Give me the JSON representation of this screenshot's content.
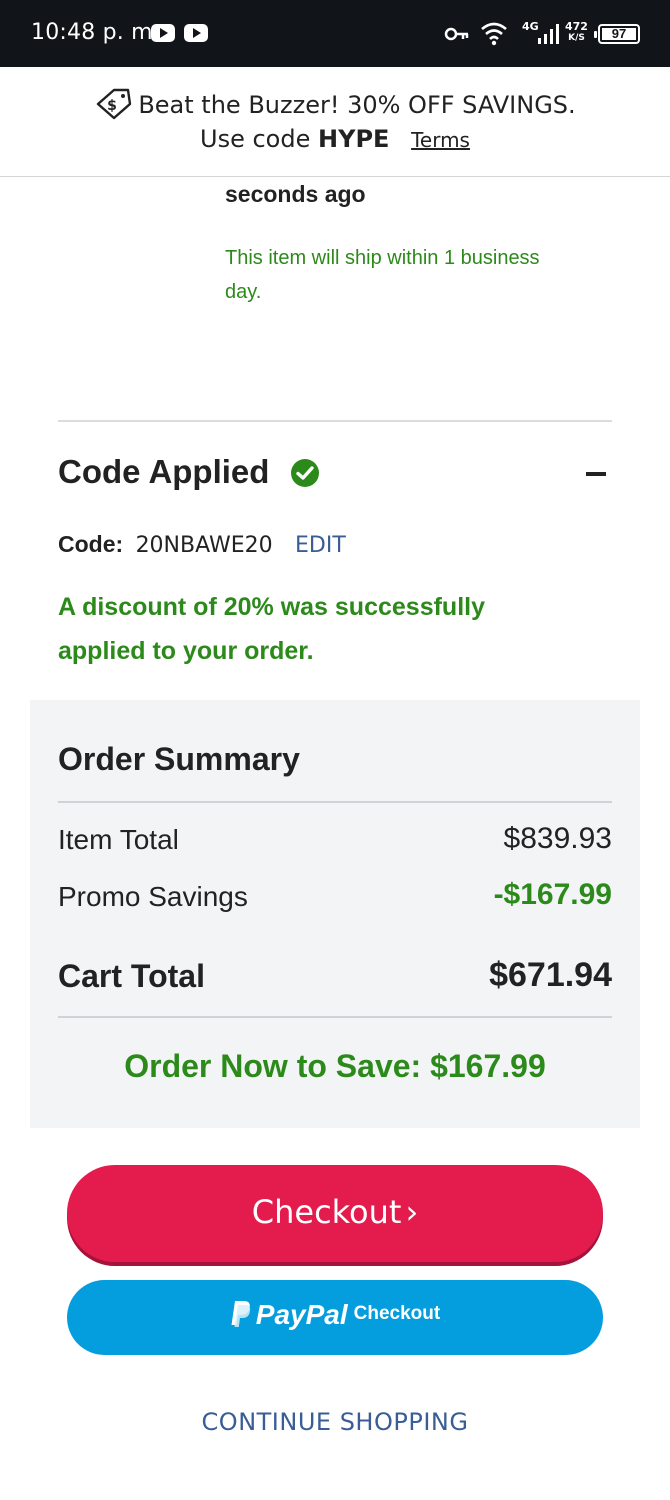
{
  "status_bar": {
    "time": "10:48 p. m.",
    "network": "4G",
    "speed_value": "472",
    "speed_unit": "K/S",
    "battery": "97"
  },
  "promo": {
    "line1": "Beat the Buzzer! 30% OFF SAVINGS.",
    "use_code_prefix": "Use code",
    "code": "HYPE",
    "terms": "Terms"
  },
  "item": {
    "seconds_ago": "seconds ago",
    "ship_note": "This item will ship within 1 business day."
  },
  "code_section": {
    "title": "Code Applied",
    "code_label": "Code:",
    "code_value": "20NBAWE20",
    "edit": "EDIT",
    "discount_message": "A discount of 20% was successfully applied to your order."
  },
  "summary": {
    "title": "Order Summary",
    "item_total_label": "Item Total",
    "item_total_value": "$839.93",
    "promo_label": "Promo Savings",
    "promo_value": "-$167.99",
    "cart_total_label": "Cart Total",
    "cart_total_value": "$671.94",
    "save_message": "Order Now to Save: $167.99"
  },
  "actions": {
    "checkout": "Checkout",
    "checkout_chevron": "›",
    "paypal_word": "PayPal",
    "paypal_checkout": "Checkout",
    "continue": "CONTINUE SHOPPING"
  },
  "colors": {
    "green": "#2c8a1b",
    "checkout_red": "#e41b4d",
    "paypal_blue": "#049ddd",
    "link_blue": "#3a5d96"
  },
  "icons": [
    "youtube-icon",
    "key-icon",
    "wifi-icon",
    "signal-icon",
    "battery-icon",
    "price-tag-icon",
    "check-circle-icon",
    "collapse-icon",
    "chevron-right-icon",
    "paypal-logo-icon"
  ]
}
